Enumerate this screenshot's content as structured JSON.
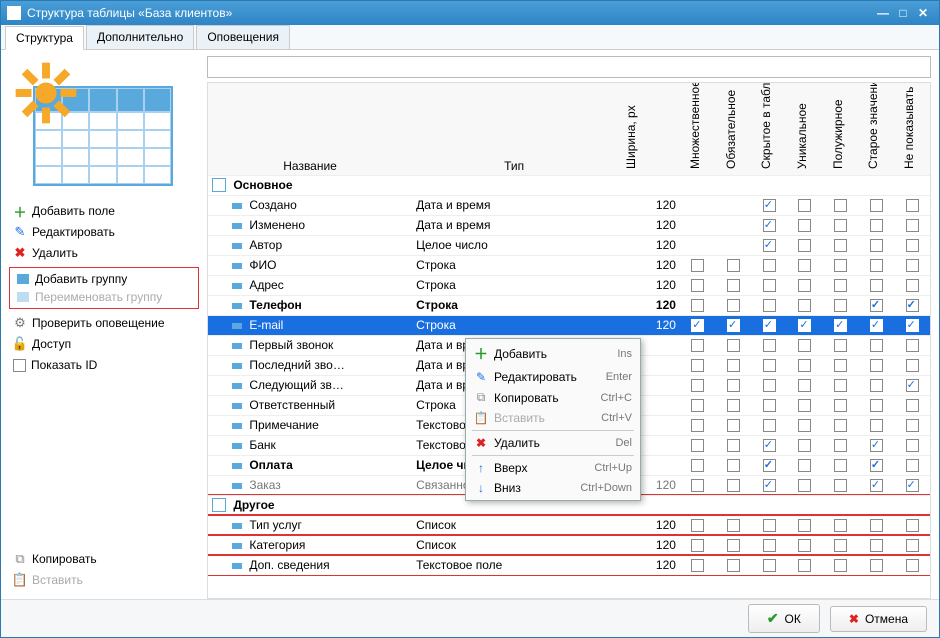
{
  "window": {
    "title": "Структура таблицы «База клиентов»"
  },
  "tabs": [
    {
      "label": "Структура",
      "active": true
    },
    {
      "label": "Дополнительно",
      "active": false
    },
    {
      "label": "Оповещения",
      "active": false
    }
  ],
  "left_actions": {
    "add_field": "Добавить поле",
    "edit": "Редактировать",
    "delete": "Удалить",
    "add_group": "Добавить группу",
    "rename_group": "Переименовать группу",
    "check_notify": "Проверить оповещение",
    "access": "Доступ",
    "show_id": "Показать ID",
    "copy": "Копировать",
    "paste": "Вставить"
  },
  "columns": {
    "name": "Название",
    "type": "Тип",
    "width": "Ширина, px",
    "multi": "Множественное",
    "required": "Обязательное",
    "hidden": "Скрытое в таблице",
    "unique": "Уникальное",
    "bold": "Полужирное",
    "old": "Старое значение",
    "nonotify": "Не показывать в оповещениях"
  },
  "groups": [
    {
      "name": "Основное",
      "highlight": false,
      "rows": [
        {
          "name": "Создано",
          "type": "Дата и время",
          "w": "120",
          "icon": "cal",
          "flags": {
            "hidden": true
          }
        },
        {
          "name": "Изменено",
          "type": "Дата и время",
          "w": "120",
          "icon": "cal",
          "flags": {
            "hidden": true
          }
        },
        {
          "name": "Автор",
          "type": "Целое число",
          "w": "120",
          "icon": "user",
          "flags": {
            "hidden": true
          }
        },
        {
          "name": "ФИО",
          "type": "Строка",
          "w": "120",
          "icon": "f",
          "flags": {}
        },
        {
          "name": "Адрес",
          "type": "Строка",
          "w": "120",
          "icon": "f",
          "flags": {}
        },
        {
          "name": "Телефон",
          "type": "Строка",
          "w": "120",
          "icon": "f",
          "bold": true,
          "flags": {
            "old": true,
            "nonotify": true
          }
        },
        {
          "name": "E-mail",
          "type": "Строка",
          "w": "120",
          "icon": "f",
          "selected": true,
          "flags": {
            "multi": true,
            "required": true,
            "hidden": true,
            "unique": true,
            "bold": true,
            "old": true,
            "nonotify": true
          }
        },
        {
          "name": "Первый звонок",
          "type": "Дата и врем",
          "w": "",
          "icon": "f",
          "flags": {}
        },
        {
          "name": "Последний зво…",
          "type": "Дата и врем",
          "w": "",
          "icon": "f",
          "flags": {}
        },
        {
          "name": "Следующий зв…",
          "type": "Дата и врем",
          "w": "",
          "icon": "f",
          "flags": {
            "nonotify": true
          }
        },
        {
          "name": "Ответственный",
          "type": "Строка",
          "w": "",
          "icon": "f",
          "flags": {}
        },
        {
          "name": "Примечание",
          "type": "Текстовое п",
          "w": "",
          "icon": "f",
          "flags": {}
        },
        {
          "name": "Банк",
          "type": "Текстовое п",
          "w": "",
          "icon": "f",
          "flags": {
            "hidden": true,
            "old": true
          }
        },
        {
          "name": "Оплата",
          "type": "Целое числ",
          "w": "",
          "icon": "f",
          "bold": true,
          "flags": {
            "hidden": true,
            "old": true
          }
        },
        {
          "name": "Заказ",
          "type": "Связанное",
          "w": "120",
          "icon": "f",
          "gray": true,
          "flags": {
            "hidden": true,
            "old": true,
            "nonotify": true
          }
        }
      ]
    },
    {
      "name": "Другое",
      "highlight": true,
      "rows": [
        {
          "name": "Тип услуг",
          "type": "Список",
          "w": "120",
          "icon": "f",
          "flags": {}
        },
        {
          "name": "Категория",
          "type": "Список",
          "w": "120",
          "icon": "f",
          "flags": {}
        },
        {
          "name": "Доп. сведения",
          "type": "Текстовое поле",
          "w": "120",
          "icon": "f",
          "flags": {}
        }
      ]
    }
  ],
  "context_menu": {
    "add": {
      "label": "Добавить",
      "key": "Ins"
    },
    "edit": {
      "label": "Редактировать",
      "key": "Enter"
    },
    "copy": {
      "label": "Копировать",
      "key": "Ctrl+C"
    },
    "paste": {
      "label": "Вставить",
      "key": "Ctrl+V"
    },
    "delete": {
      "label": "Удалить",
      "key": "Del"
    },
    "up": {
      "label": "Вверх",
      "key": "Ctrl+Up"
    },
    "down": {
      "label": "Вниз",
      "key": "Ctrl+Down"
    }
  },
  "footer": {
    "ok": "ОК",
    "cancel": "Отмена"
  }
}
